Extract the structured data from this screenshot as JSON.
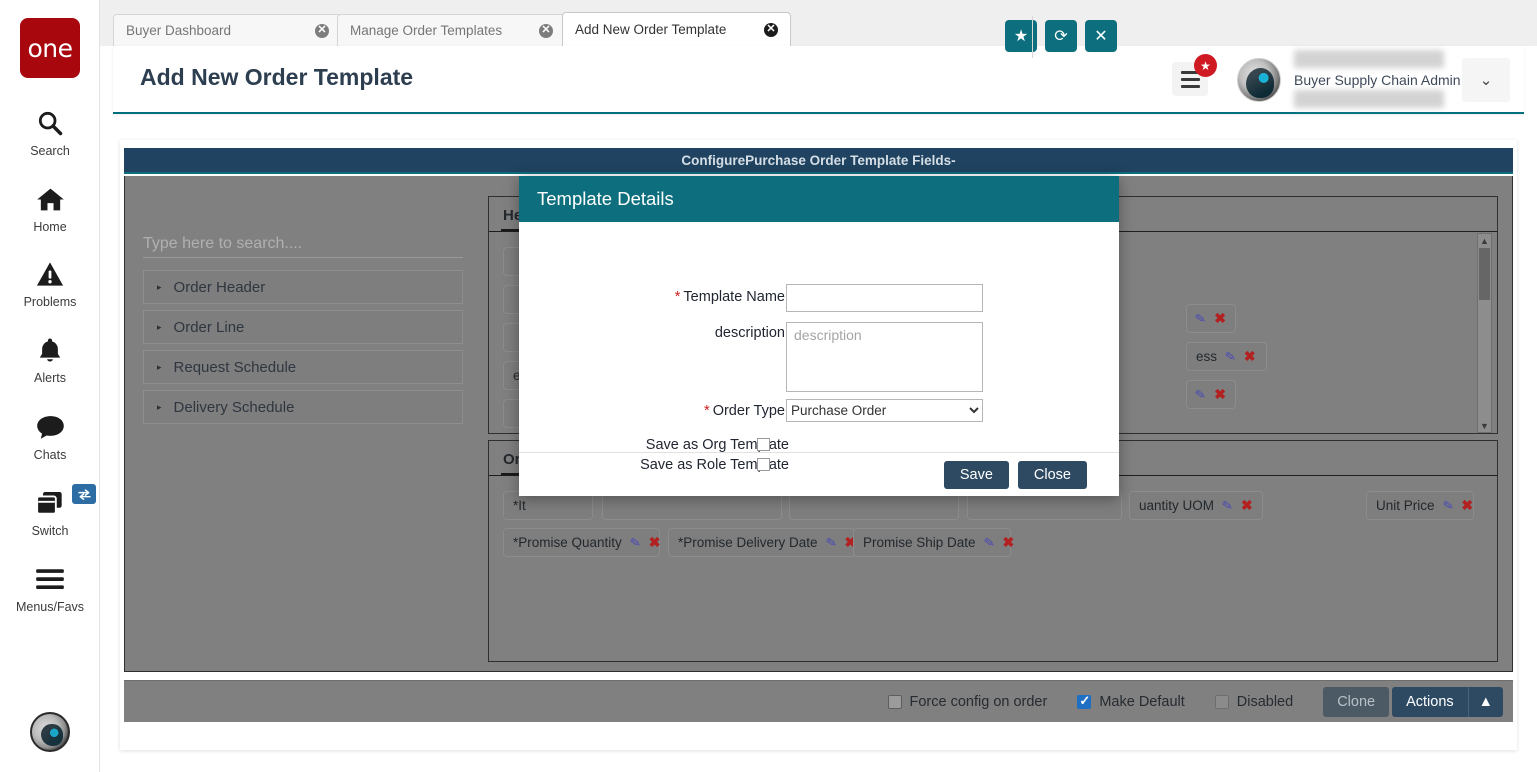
{
  "brand": {
    "logo_text": "one",
    "logo_color": "#a8080d",
    "accent": "#0d6f7e",
    "header_bar": "#1f4360"
  },
  "rail": {
    "items": [
      {
        "label": "Search",
        "icon": "search-icon"
      },
      {
        "label": "Home",
        "icon": "home-icon"
      },
      {
        "label": "Problems",
        "icon": "warning-triangle-icon"
      },
      {
        "label": "Alerts",
        "icon": "bell-icon"
      },
      {
        "label": "Chats",
        "icon": "chat-bubble-icon"
      },
      {
        "label": "Switch",
        "icon": "windows-stack-icon"
      },
      {
        "label": "Menus/Favs",
        "icon": "hamburger-icon"
      }
    ]
  },
  "tabs": [
    {
      "label": "Buyer Dashboard",
      "active": false
    },
    {
      "label": "Manage Order Templates",
      "active": false
    },
    {
      "label": "Add New Order Template",
      "active": true
    }
  ],
  "header": {
    "title": "Add New Order Template",
    "buttons": [
      {
        "name": "favorite-button",
        "glyph": "★"
      },
      {
        "name": "refresh-button",
        "glyph": "⟳"
      },
      {
        "name": "close-button",
        "glyph": "✕"
      }
    ],
    "favorites_badge": "★",
    "user_name": "Buyer Supply Chain Admin",
    "user_caret": "⌄"
  },
  "configure": {
    "bar_title": "ConfigurePurchase Order Template Fields-",
    "search_placeholder": "Type here to search....",
    "accordion": [
      {
        "label": "Order Header",
        "caret": "▸"
      },
      {
        "label": "Order Line",
        "caret": "▸"
      },
      {
        "label": "Request Schedule",
        "caret": "▸"
      },
      {
        "label": "Delivery Schedule",
        "caret": "▸"
      }
    ],
    "header_panel": {
      "tab_label": "Header"
    },
    "line_panel": {
      "tab_label": "Order Line"
    },
    "header_chips": [
      {
        "label": "",
        "row": 0
      },
      {
        "label": "",
        "row": 1
      },
      {
        "label": "",
        "row": 2
      },
      {
        "label": "ess",
        "row": 3
      },
      {
        "label": "",
        "row": 4
      }
    ],
    "line_chips_row1": [
      {
        "label": "*It"
      },
      {
        "label": ""
      },
      {
        "label": ""
      },
      {
        "label": ""
      },
      {
        "label": "uantity UOM"
      },
      {
        "label": "Unit Price"
      }
    ],
    "line_chips_row2": [
      {
        "label": "*Promise Quantity"
      },
      {
        "label": "*Promise Delivery Date"
      },
      {
        "label": "Promise Ship Date"
      }
    ],
    "chip_icons": {
      "edit": "✎",
      "remove": "✖"
    }
  },
  "footer": {
    "checkboxes": [
      {
        "label": "Force config on order",
        "checked": false,
        "muted": false
      },
      {
        "label": "Make Default",
        "checked": true,
        "muted": false
      },
      {
        "label": "Disabled",
        "checked": false,
        "muted": true
      }
    ],
    "clone_label": "Clone",
    "actions_label": "Actions",
    "actions_caret": "▲"
  },
  "modal": {
    "title": "Template Details",
    "template_name_label": "Template Name:",
    "template_name_value": "",
    "template_name_required": "*",
    "description_label": "description:",
    "description_placeholder": "description",
    "description_value": "",
    "order_type_label": "Order Type:",
    "order_type_required": "*",
    "order_type_value": "Purchase Order",
    "order_type_options": [
      "Purchase Order"
    ],
    "save_as_org_label": "Save as Org Template",
    "save_as_org_checked": false,
    "save_as_role_label": "Save as Role Template",
    "save_as_role_checked": false,
    "save_label": "Save",
    "close_label": "Close"
  }
}
